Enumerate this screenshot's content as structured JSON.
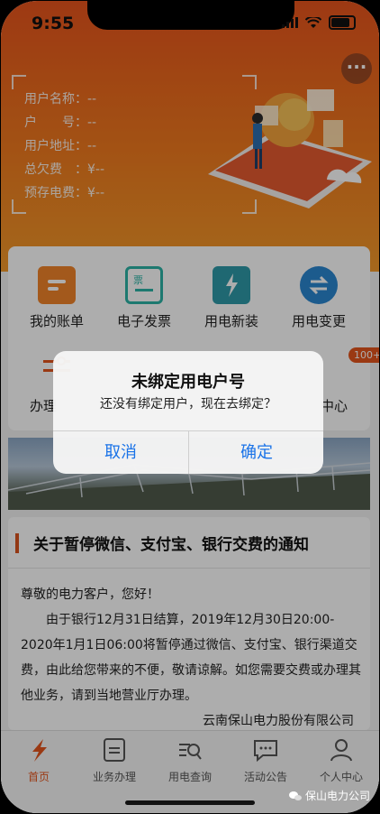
{
  "status": {
    "time": "9:55"
  },
  "header": {
    "more_label": "···",
    "info": [
      {
        "label": "用户名称：",
        "value": "--"
      },
      {
        "label": "户　　号：",
        "value": "--"
      },
      {
        "label": "用户地址：",
        "value": "--"
      },
      {
        "label": "总欠费　：",
        "value": "¥--"
      },
      {
        "label": "预存电费：",
        "value": "¥--"
      }
    ]
  },
  "services": [
    {
      "label": "我的账单",
      "icon": "bill-icon",
      "color": "#f0842a"
    },
    {
      "label": "电子发票",
      "icon": "invoice-icon",
      "color": "#2bb3a5"
    },
    {
      "label": "用电新装",
      "icon": "new-install-icon",
      "color": "#2f9aa8"
    },
    {
      "label": "用电变更",
      "icon": "change-icon",
      "color": "#2a86d0"
    },
    {
      "label": "办理",
      "icon": "handle-icon",
      "color": "#e4551d"
    },
    {
      "label": "中心",
      "icon": "center-icon",
      "color": "#e4551d",
      "badge": "100+"
    }
  ],
  "notice": {
    "title": "关于暂停微信、支付宝、银行交费的通知",
    "greeting": "尊敬的电力客户，您好！",
    "body": "由于银行12月31日结算，2019年12月30日20:00-2020年1月1日06:00将暂停通过微信、支付宝、银行渠道交费，由此给您带来的不便，敬请谅解。如您需要交费或办理其他业务，请到当地营业厅办理。",
    "signature": "云南保山电力股份有限公司"
  },
  "tabs": [
    {
      "label": "首页",
      "icon": "lightning-icon",
      "active": true
    },
    {
      "label": "业务办理",
      "icon": "business-icon",
      "active": false
    },
    {
      "label": "用电查询",
      "icon": "query-icon",
      "active": false
    },
    {
      "label": "活动公告",
      "icon": "announcement-icon",
      "active": false
    },
    {
      "label": "个人中心",
      "icon": "profile-icon",
      "active": false
    }
  ],
  "dialog": {
    "title": "未绑定用电户号",
    "message": "还没有绑定用户，现在去绑定？",
    "cancel_label": "取消",
    "confirm_label": "确定"
  },
  "watermark": "保山电力公司",
  "colors": {
    "accent": "#e4551d",
    "link": "#1a73e8"
  }
}
